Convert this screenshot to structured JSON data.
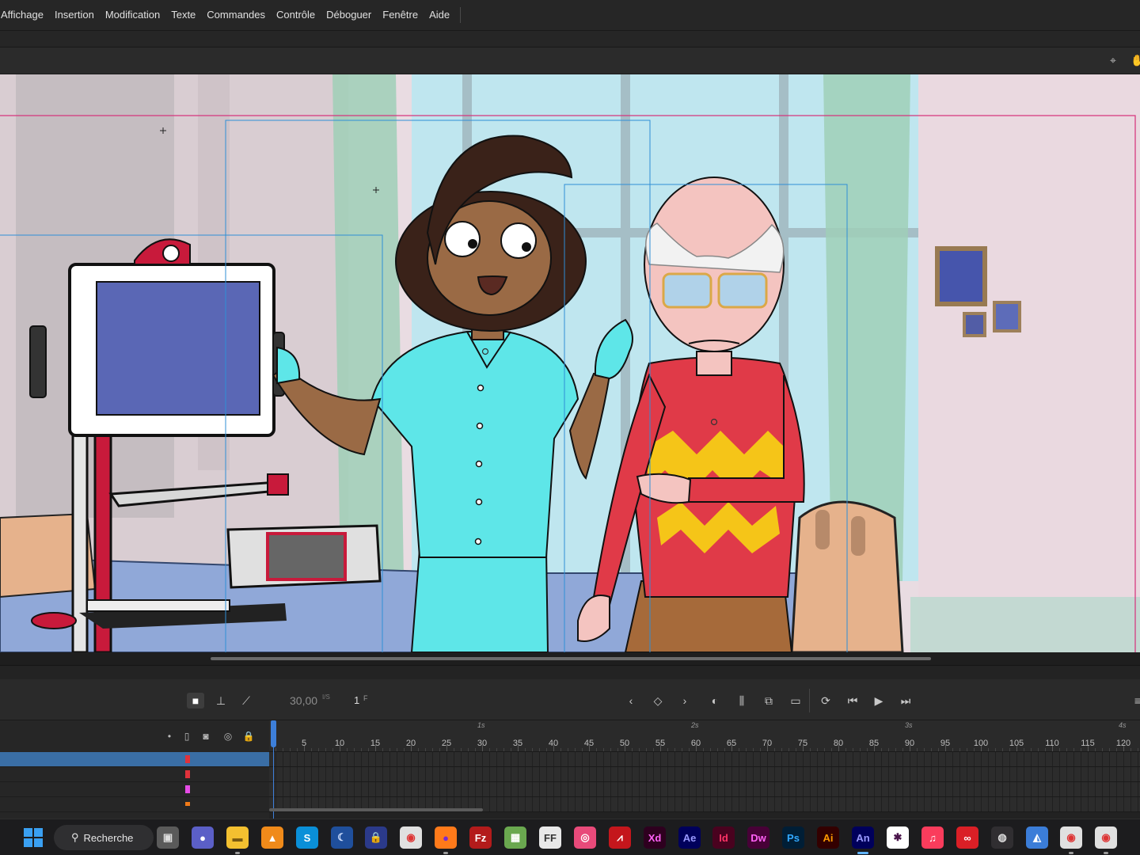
{
  "menu": [
    "Affichage",
    "Insertion",
    "Modification",
    "Texte",
    "Commandes",
    "Contrôle",
    "Déboguer",
    "Fenêtre",
    "Aide"
  ],
  "timeline": {
    "fps_value": "30,00",
    "fps_unit": "I/S",
    "frame_value": "1",
    "frame_unit": "F",
    "frame_ticks": [
      "5",
      "10",
      "15",
      "20",
      "25",
      "30",
      "35",
      "40",
      "45",
      "50",
      "55",
      "60",
      "65",
      "70",
      "75",
      "80",
      "85",
      "90",
      "95",
      "100",
      "105",
      "110",
      "115",
      "120"
    ],
    "seconds": [
      "1s",
      "2s",
      "3s",
      "4s"
    ],
    "layer_colors": [
      "#e0323b",
      "#e0323b",
      "#e64ce6",
      "#f07a18"
    ]
  },
  "taskbar": {
    "search_label": "Recherche",
    "apps": [
      {
        "icon": "task-view-icon",
        "label": ""
      },
      {
        "icon": "teams-icon",
        "label": ""
      },
      {
        "icon": "file-explorer-icon",
        "label": ""
      },
      {
        "icon": "vlc-icon",
        "label": ""
      },
      {
        "icon": "skype-icon",
        "label": "S"
      },
      {
        "icon": "moon-app-icon",
        "label": ""
      },
      {
        "icon": "lock-app-icon",
        "label": ""
      },
      {
        "icon": "chrome-icon",
        "label": ""
      },
      {
        "icon": "firefox-icon",
        "label": ""
      },
      {
        "icon": "filezilla-icon",
        "label": "Fz"
      },
      {
        "icon": "spreadsheet-icon",
        "label": ""
      },
      {
        "icon": "ffdec-icon",
        "label": "FF"
      },
      {
        "icon": "photo-app-icon",
        "label": ""
      },
      {
        "icon": "acrobat-icon",
        "label": ""
      },
      {
        "icon": "adobe-xd-icon",
        "label": "Xd"
      },
      {
        "icon": "after-effects-icon",
        "label": "Ae"
      },
      {
        "icon": "indesign-icon",
        "label": "Id"
      },
      {
        "icon": "dreamweaver-icon",
        "label": "Dw"
      },
      {
        "icon": "photoshop-icon",
        "label": "Ps"
      },
      {
        "icon": "illustrator-icon",
        "label": "Ai"
      },
      {
        "icon": "animate-icon",
        "label": "An"
      },
      {
        "icon": "slack-icon",
        "label": ""
      },
      {
        "icon": "itunes-icon",
        "label": ""
      },
      {
        "icon": "creative-cloud-icon",
        "label": ""
      },
      {
        "icon": "obs-icon",
        "label": ""
      },
      {
        "icon": "image-viewer-icon",
        "label": ""
      },
      {
        "icon": "chrome-profile-icon",
        "label": ""
      },
      {
        "icon": "chrome-profile-2-icon",
        "label": ""
      }
    ]
  }
}
